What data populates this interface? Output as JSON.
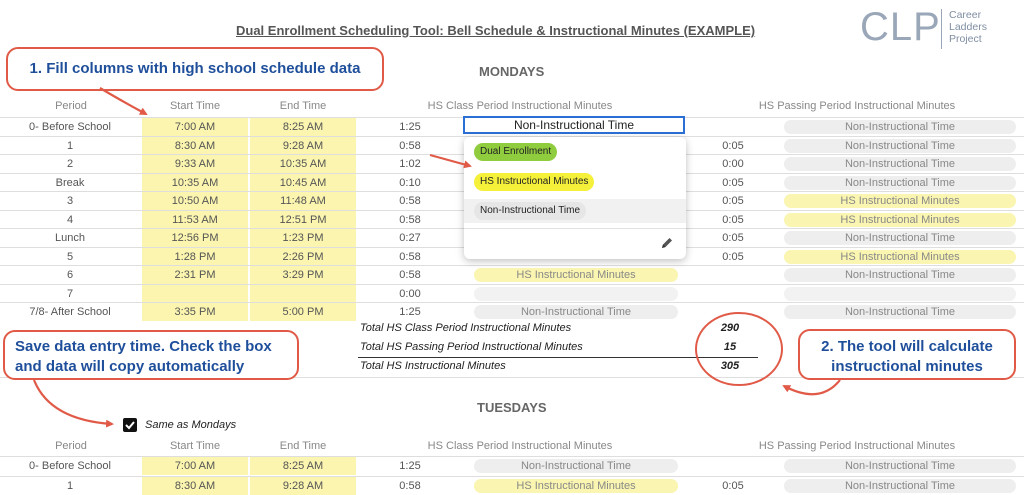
{
  "title": "Dual Enrollment Scheduling Tool: Bell Schedule & Instructional Minutes (EXAMPLE)",
  "logo": {
    "letters": "CLP",
    "line1": "Career",
    "line2": "Ladders",
    "line3": "Project"
  },
  "callouts": {
    "fill": "1.  Fill columns with high school schedule data",
    "save_line1": "Save data entry time. Check the box",
    "save_line2": "and data will copy automatically",
    "calc_line1": "2.   The tool will calculate",
    "calc_line2": "instructional minutes"
  },
  "headers": {
    "period": "Period",
    "start": "Start Time",
    "end": "End Time",
    "class_minutes": "HS Class Period Instructional Minutes",
    "passing_minutes": "HS Passing Period Instructional Minutes"
  },
  "monday": {
    "title": "MONDAYS",
    "active_cell": "Non-Instructional Time",
    "rows": [
      {
        "period": "0- Before School",
        "start": "7:00 AM",
        "end": "8:25 AM",
        "duration": "1:25",
        "class": "",
        "pass_dur": "",
        "passing": "Non-Instructional Time",
        "passing_type": "grey"
      },
      {
        "period": "1",
        "start": "8:30 AM",
        "end": "9:28 AM",
        "duration": "0:58",
        "class": "",
        "pass_dur": "0:05",
        "passing": "Non-Instructional Time",
        "passing_type": "grey"
      },
      {
        "period": "2",
        "start": "9:33 AM",
        "end": "10:35 AM",
        "duration": "1:02",
        "class": "",
        "pass_dur": "0:00",
        "passing": "Non-Instructional Time",
        "passing_type": "grey"
      },
      {
        "period": "Break",
        "start": "10:35 AM",
        "end": "10:45 AM",
        "duration": "0:10",
        "class": "",
        "pass_dur": "0:05",
        "passing": "Non-Instructional Time",
        "passing_type": "grey"
      },
      {
        "period": "3",
        "start": "10:50 AM",
        "end": "11:48 AM",
        "duration": "0:58",
        "class": "",
        "pass_dur": "0:05",
        "passing": "HS Instructional Minutes",
        "passing_type": "yellow"
      },
      {
        "period": "4",
        "start": "11:53 AM",
        "end": "12:51 PM",
        "duration": "0:58",
        "class": "",
        "pass_dur": "0:05",
        "passing": "HS Instructional Minutes",
        "passing_type": "yellow"
      },
      {
        "period": "Lunch",
        "start": "12:56 PM",
        "end": "1:23 PM",
        "duration": "0:27",
        "class": "",
        "pass_dur": "0:05",
        "passing": "Non-Instructional Time",
        "passing_type": "grey"
      },
      {
        "period": "5",
        "start": "1:28 PM",
        "end": "2:26 PM",
        "duration": "0:58",
        "class": "",
        "pass_dur": "0:05",
        "passing": "HS Instructional Minutes",
        "passing_type": "yellow"
      },
      {
        "period": "6",
        "start": "2:31 PM",
        "end": "3:29 PM",
        "duration": "0:58",
        "class": "HS Instructional Minutes",
        "class_type": "yellow",
        "pass_dur": "",
        "passing": "Non-Instructional Time",
        "passing_type": "grey"
      },
      {
        "period": "7",
        "start": "",
        "end": "",
        "duration": "0:00",
        "class": "",
        "class_type": "empty",
        "pass_dur": "",
        "passing": "",
        "passing_type": "empty"
      },
      {
        "period": "7/8- After School",
        "start": "3:35 PM",
        "end": "5:00 PM",
        "duration": "1:25",
        "class": "Non-Instructional Time",
        "class_type": "grey",
        "pass_dur": "",
        "passing": "Non-Instructional Time",
        "passing_type": "grey"
      }
    ],
    "dropdown": {
      "options": [
        "Dual Enrollment",
        "HS Instructional Minutes",
        "Non-Instructional Time"
      ],
      "colors": [
        "#8fcc3e",
        "#f5f03a",
        "#e6e6e6"
      ],
      "edit_icon": "pencil-icon"
    },
    "totals": [
      {
        "label": "Total HS Class Period Instructional Minutes",
        "value": "290"
      },
      {
        "label": "Total HS Passing Period Instructional Minutes",
        "value": "15"
      },
      {
        "label": "Total HS Instructional Minutes",
        "value": "305"
      }
    ]
  },
  "tuesday": {
    "title": "TUESDAYS",
    "checkbox_label": "Same as Mondays",
    "checked": true,
    "rows": [
      {
        "period": "0- Before School",
        "start": "7:00 AM",
        "end": "8:25 AM",
        "duration": "1:25",
        "class": "Non-Instructional Time",
        "class_type": "grey",
        "pass_dur": "",
        "passing": "Non-Instructional Time",
        "passing_type": "grey"
      },
      {
        "period": "1",
        "start": "8:30 AM",
        "end": "9:28 AM",
        "duration": "0:58",
        "class": "HS Instructional Minutes",
        "class_type": "yellow",
        "pass_dur": "0:05",
        "passing": "Non-Instructional Time",
        "passing_type": "grey"
      }
    ]
  },
  "colors": {
    "accent": "#e05a47",
    "callout_text": "#1f4f9b",
    "input_yellow": "#fbf5b0"
  }
}
